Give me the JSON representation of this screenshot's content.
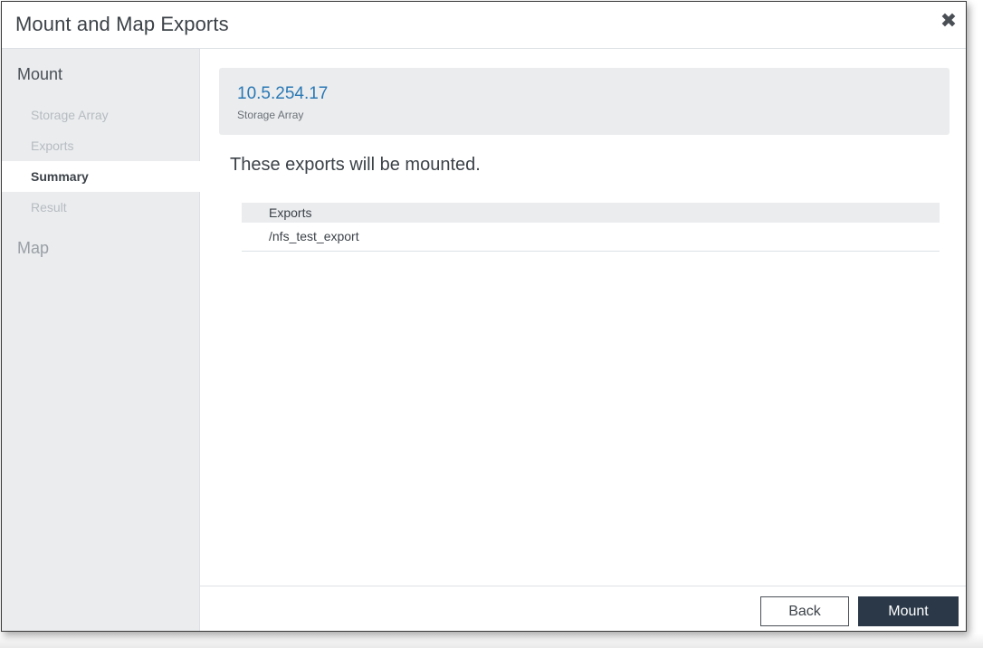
{
  "dialog": {
    "title": "Mount and Map Exports",
    "close_icon": "close-icon"
  },
  "sidebar": {
    "mount_section": "Mount",
    "steps": [
      {
        "label": "Storage Array",
        "active": false
      },
      {
        "label": "Exports",
        "active": false
      },
      {
        "label": "Summary",
        "active": true
      },
      {
        "label": "Result",
        "active": false
      }
    ],
    "map_section": "Map"
  },
  "main": {
    "storage_array": {
      "ip": "10.5.254.17",
      "label": "Storage Array"
    },
    "message": "These exports will be mounted.",
    "table": {
      "header": "Exports",
      "rows": [
        "/nfs_test_export"
      ]
    }
  },
  "footer": {
    "back_label": "Back",
    "mount_label": "Mount"
  },
  "colors": {
    "accent": "#2a78b4",
    "primary_button": "#2a3848",
    "sidebar_bg": "#eaecee"
  }
}
